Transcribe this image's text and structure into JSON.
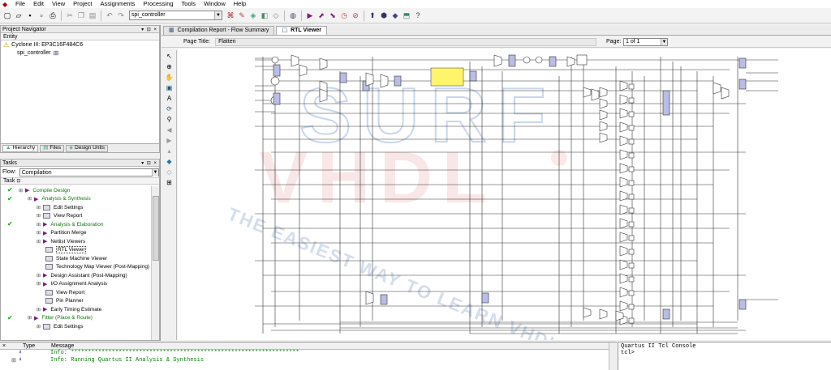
{
  "menu": [
    "File",
    "Edit",
    "View",
    "Project",
    "Assignments",
    "Processing",
    "Tools",
    "Window",
    "Help"
  ],
  "toolbar": {
    "entity_combo": "spi_controller"
  },
  "navigator": {
    "title": "Project Navigator",
    "column": "Entity",
    "device": "Cyclone III: EP3C16F484C6",
    "entity": "spi_controller",
    "tabs": [
      "Hierarchy",
      "Files",
      "Design Units"
    ]
  },
  "tasks": {
    "title": "Tasks",
    "flow_label": "Flow:",
    "flow_value": "Compilation",
    "column": "Task",
    "items": [
      {
        "label": "Compile Design",
        "level": 0,
        "checked": true,
        "green": true
      },
      {
        "label": "Analysis & Synthesis",
        "level": 1,
        "checked": true,
        "green": true
      },
      {
        "label": "Edit Settings",
        "level": 2,
        "checked": false,
        "green": false
      },
      {
        "label": "View Report",
        "level": 2,
        "checked": false,
        "green": false
      },
      {
        "label": "Analysis & Elaboration",
        "level": 2,
        "checked": true,
        "green": true
      },
      {
        "label": "Partition Merge",
        "level": 2,
        "checked": false,
        "green": false
      },
      {
        "label": "Netlist Viewers",
        "level": 2,
        "checked": false,
        "green": false
      },
      {
        "label": "RTL Viewer",
        "level": 3,
        "checked": false,
        "green": false,
        "selected": true
      },
      {
        "label": "State Machine Viewer",
        "level": 3,
        "checked": false,
        "green": false
      },
      {
        "label": "Technology Map Viewer (Post-Mapping)",
        "level": 3,
        "checked": false,
        "green": false
      },
      {
        "label": "Design Assistant (Post-Mapping)",
        "level": 2,
        "checked": false,
        "green": false
      },
      {
        "label": "I/O Assignment Analysis",
        "level": 2,
        "checked": false,
        "green": false
      },
      {
        "label": "View Report",
        "level": 3,
        "checked": false,
        "green": false
      },
      {
        "label": "Pin Planner",
        "level": 3,
        "checked": false,
        "green": false
      },
      {
        "label": "Early Timing Estimate",
        "level": 2,
        "checked": false,
        "green": false
      },
      {
        "label": "Fitter (Place & Route)",
        "level": 1,
        "checked": true,
        "green": true
      },
      {
        "label": "Edit Settings",
        "level": 2,
        "checked": false,
        "green": false
      }
    ]
  },
  "doc_tabs": [
    "Compilation Report - Flow Summary",
    "RTL Viewer"
  ],
  "pagebar": {
    "page_title_label": "Page Title:",
    "page_title": "Flatten",
    "page_label": "Page:",
    "page_value": "1 of 1"
  },
  "watermark": {
    "line1": "SURF",
    "line2": "VHDL",
    "tagline": "THE EASIEST WAY TO LEARN VHDL",
    "color": "#c9d6ec",
    "accent": "#f3c6c6"
  },
  "messages": {
    "col_type": "Type",
    "col_message": "Message",
    "rows": [
      "Info: *******************************************************************",
      "Info: Running Quartus II Analysis & Synthesis"
    ]
  },
  "console": {
    "title": "Quartus II Tcl Console",
    "prompt": "tcl>"
  }
}
